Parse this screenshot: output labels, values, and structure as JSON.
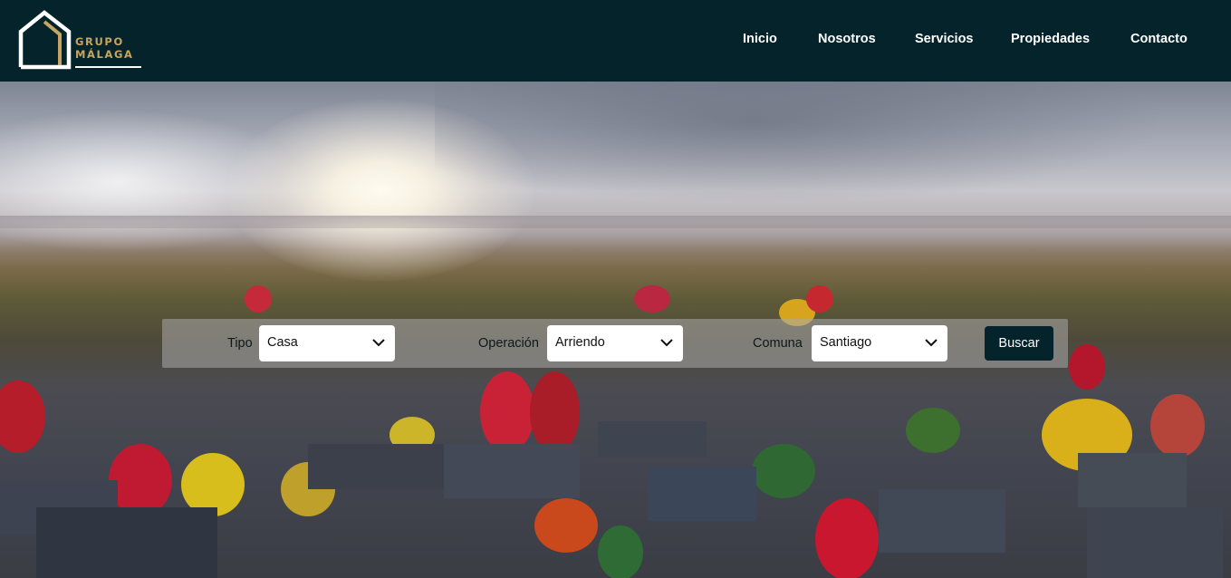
{
  "brand": {
    "line1": "GRUPO",
    "line2": "MÁLAGA",
    "accent_color": "#c7a461",
    "header_color": "#04232a"
  },
  "nav": {
    "items": [
      {
        "label": "Inicio"
      },
      {
        "label": "Nosotros"
      },
      {
        "label": "Servicios"
      },
      {
        "label": "Propiedades"
      },
      {
        "label": "Contacto"
      }
    ]
  },
  "search": {
    "tipo_label": "Tipo",
    "tipo_value": "Casa",
    "operacion_label": "Operación",
    "operacion_value": "Arriendo",
    "comuna_label": "Comuna",
    "comuna_value": "Santiago",
    "submit_label": "Buscar"
  }
}
